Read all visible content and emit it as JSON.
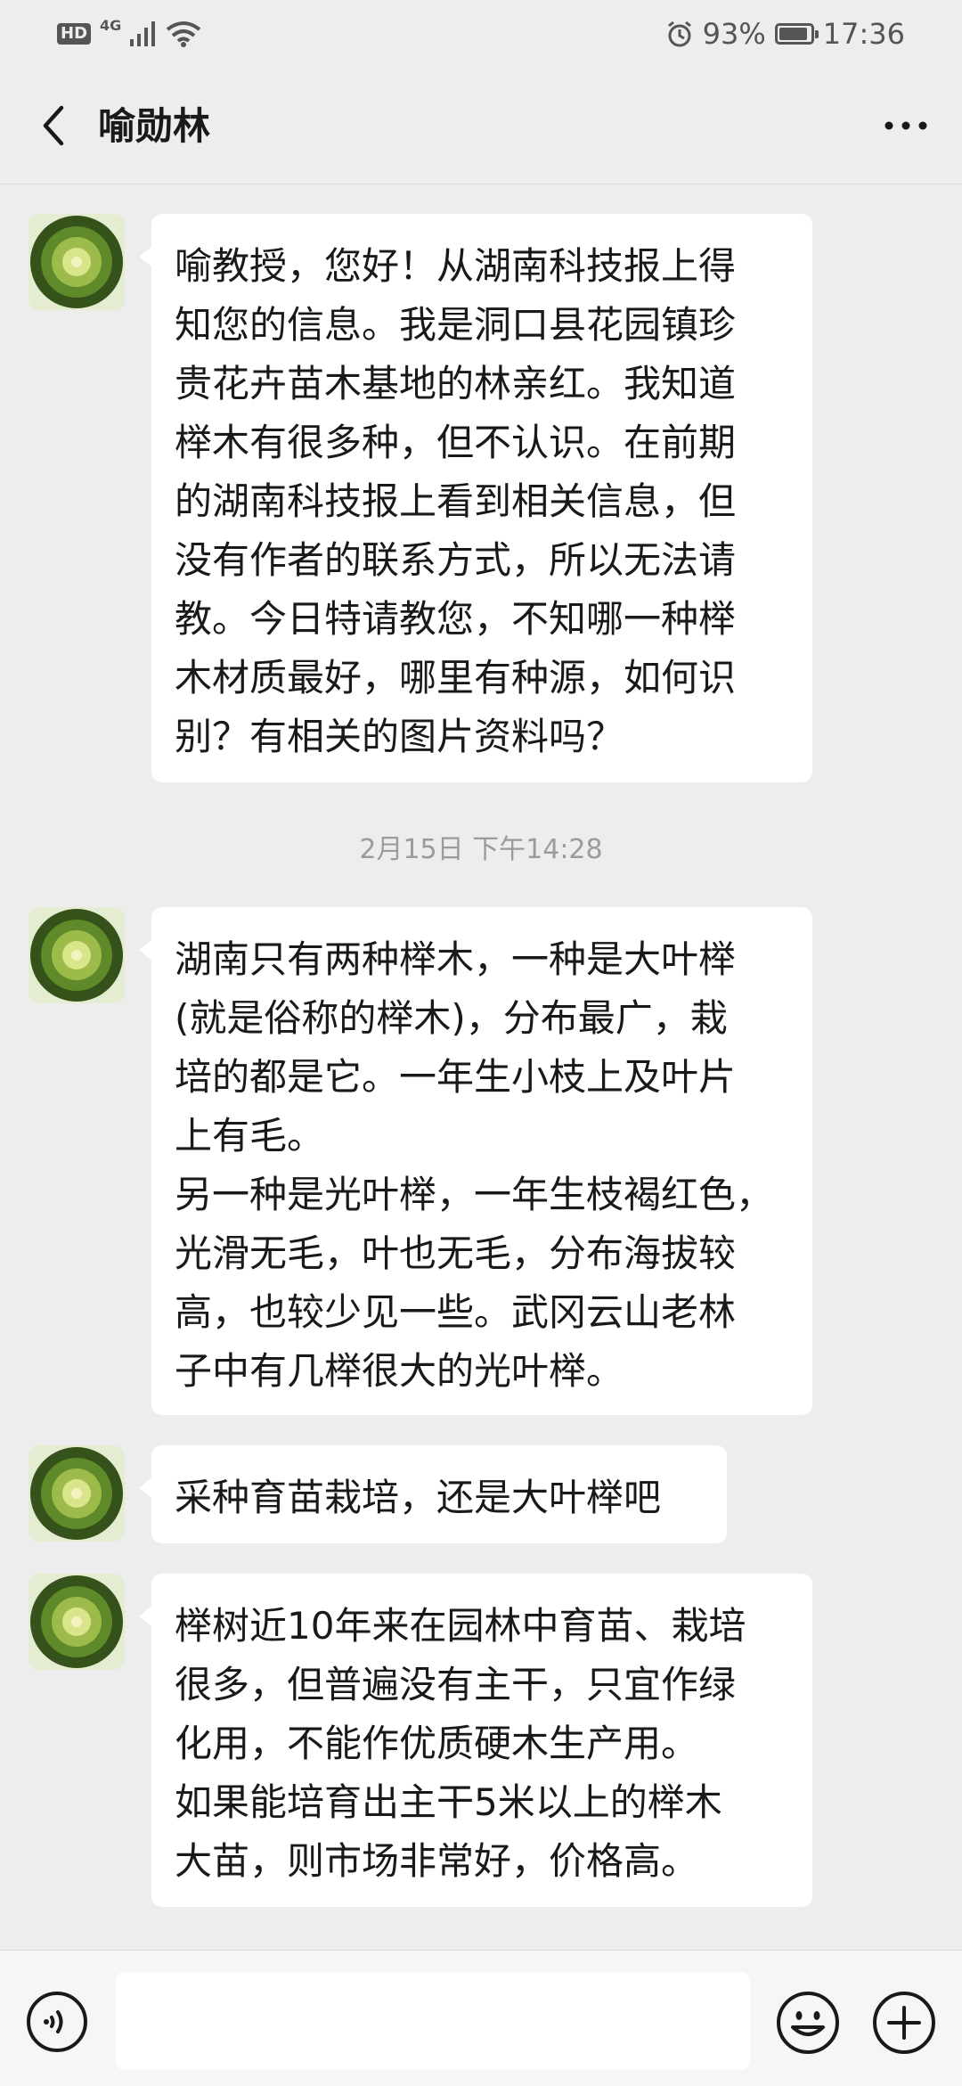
{
  "status_bar": {
    "hd": "HD",
    "network": "4G",
    "battery": "93%",
    "time": "17:36"
  },
  "header": {
    "title": "喻勋林",
    "back_icon": "chevron-left-icon",
    "more_icon": "more-dots-icon"
  },
  "messages": [
    {
      "type": "received",
      "text": "喻教授，您好！从湖南科技报上得\n知您的信息。我是洞口县花园镇珍\n贵花卉苗木基地的林亲红。我知道\n榉木有很多种，但不认识。在前期\n的湖南科技报上看到相关信息，但\n没有作者的联系方式，所以无法请\n教。今日特请教您，不知哪一种榉\n木材质最好，哪里有种源，如何识\n别？有相关的图片资料吗？"
    },
    {
      "type": "received",
      "text": "湖南只有两种榉木，一种是大叶榉\n(就是俗称的榉木)，分布最广，栽\n培的都是它。一年生小枝上及叶片\n上有毛。\n另一种是光叶榉，一年生枝褐红色，\n光滑无毛，叶也无毛，分布海拔较\n高，也较少见一些。武冈云山老林\n子中有几榉很大的光叶榉。"
    },
    {
      "type": "received",
      "text": "采种育苗栽培，还是大叶榉吧"
    },
    {
      "type": "received",
      "text": "榉树近10年来在园林中育苗、栽培\n很多，但普遍没有主干，只宜作绿\n化用，不能作优质硬木生产用。\n如果能培育出主干5米以上的榉木\n大苗，则市场非常好，价格高。"
    }
  ],
  "timestamp": "2月15日 下午14:28",
  "input_bar": {
    "voice_icon": "voice-icon",
    "emoji_icon": "emoji-icon",
    "plus_icon": "plus-icon",
    "input_value": ""
  }
}
